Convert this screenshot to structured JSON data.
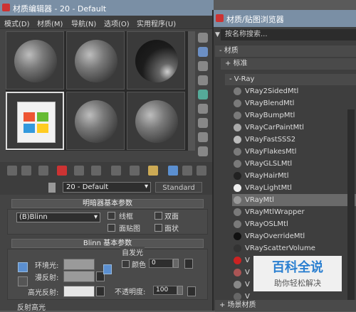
{
  "editor": {
    "title": "材质编辑器 - 20 - Default",
    "menu": [
      "模式(D)",
      "材质(M)",
      "导航(N)",
      "选项(O)",
      "实用程序(U)"
    ],
    "material_name": "20 - Default",
    "material_type": "Standard",
    "shader_rollout": {
      "title": "明暗器基本参数",
      "shader": "(B)Blinn",
      "options": [
        "线框",
        "双面",
        "面贴图",
        "面状"
      ]
    },
    "blinn_rollout": {
      "title": "Blinn 基本参数",
      "self_illum_group": "自发光",
      "color_label": "颜色",
      "color_value": "0",
      "ambient_label": "环境光:",
      "diffuse_label": "漫反射:",
      "specular_label": "高光反射:",
      "opacity_label": "不透明度:",
      "opacity_value": "100",
      "highlight_group": "反射高光"
    }
  },
  "browser": {
    "title": "材质/贴图浏览器",
    "search_placeholder": "按名称搜索...",
    "sections": {
      "materials": "- 材质",
      "standard": "+ 标准",
      "vray": "- V-Ray",
      "scene": "+ 场景材质"
    },
    "vray_items": [
      "VRay2SidedMtl",
      "VRayBlendMtl",
      "VRayBumpMtl",
      "VRayCarPaintMtl",
      "VRayFastSSS2",
      "VRayFlakesMtl",
      "VRayGLSLMtl",
      "VRayHairMtl",
      "VRayLightMtl",
      "VRayMtl",
      "VRayMtlWrapper",
      "VRayOSLMtl",
      "VRayOverrideMtl",
      "VRayScatterVolume",
      "V",
      "V",
      "V",
      "V"
    ],
    "selected": "VRayMtl"
  },
  "watermark": {
    "main": "百科全说",
    "sub": "助你轻松解决"
  },
  "colors": {
    "title_bar": "#7a8fa5",
    "accent": "#2a7fd0"
  }
}
